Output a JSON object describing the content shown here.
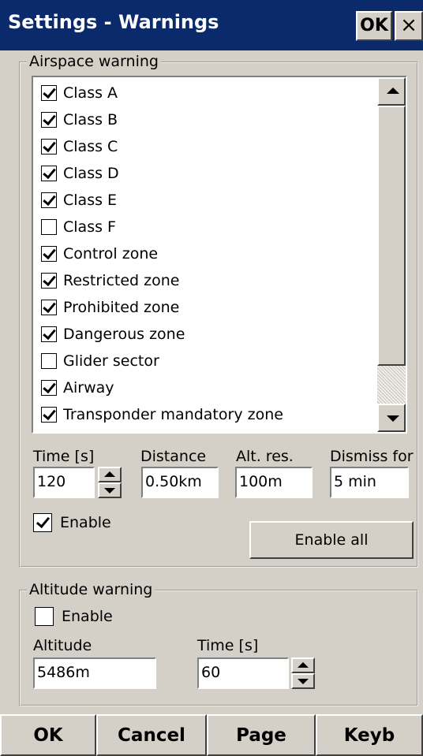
{
  "titlebar": {
    "title": "Settings - Warnings",
    "ok_label": "OK",
    "close_label": "×"
  },
  "airspace": {
    "legend": "Airspace warning",
    "items": [
      {
        "label": "Class A",
        "checked": true
      },
      {
        "label": "Class B",
        "checked": true
      },
      {
        "label": "Class C",
        "checked": true
      },
      {
        "label": "Class D",
        "checked": true
      },
      {
        "label": "Class E",
        "checked": true
      },
      {
        "label": "Class F",
        "checked": false
      },
      {
        "label": "Control zone",
        "checked": true
      },
      {
        "label": "Restricted zone",
        "checked": true
      },
      {
        "label": "Prohibited zone",
        "checked": true
      },
      {
        "label": "Dangerous zone",
        "checked": true
      },
      {
        "label": "Glider sector",
        "checked": false
      },
      {
        "label": "Airway",
        "checked": true
      },
      {
        "label": "Transponder mandatory zone",
        "checked": true
      }
    ],
    "time_label": "Time [s]",
    "time_value": "120",
    "distance_label": "Distance",
    "distance_value": "0.50km",
    "altres_label": "Alt. res.",
    "altres_value": "100m",
    "dismiss_label": "Dismiss for",
    "dismiss_value": "5 min",
    "enable_label": "Enable",
    "enable_checked": true,
    "enable_all_label": "Enable all"
  },
  "altitude": {
    "legend": "Altitude warning",
    "enable_label": "Enable",
    "enable_checked": false,
    "altitude_label": "Altitude",
    "altitude_value": "5486m",
    "time_label": "Time [s]",
    "time_value": "60"
  },
  "bottom": {
    "ok": "OK",
    "cancel": "Cancel",
    "page": "Page",
    "keyb": "Keyb"
  }
}
